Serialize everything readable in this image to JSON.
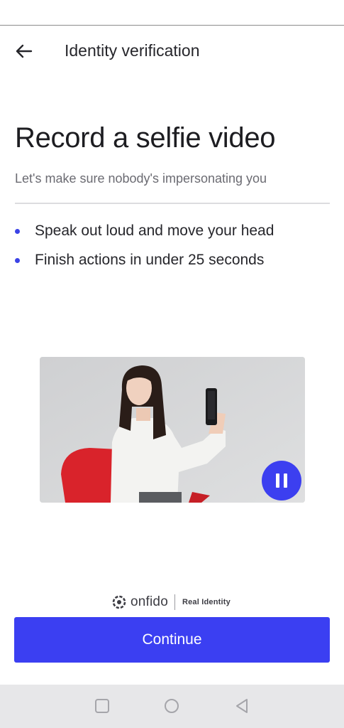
{
  "header": {
    "title": "Identity verification",
    "back_icon": "arrow-left-icon"
  },
  "main": {
    "heading": "Record a selfie video",
    "subtitle": "Let's make sure nobody's impersonating you",
    "bullets": [
      "Speak out loud and move your head",
      "Finish actions in under 25 seconds"
    ],
    "video": {
      "state": "playing",
      "control_icon": "pause-icon"
    }
  },
  "branding": {
    "logo_icon": "onfido-logo-icon",
    "name": "onfido",
    "tagline": "Real Identity"
  },
  "actions": {
    "continue_label": "Continue"
  },
  "system_nav": {
    "items": [
      "recent-apps-icon",
      "home-icon",
      "back-triangle-icon"
    ]
  },
  "colors": {
    "accent": "#3b3ff2",
    "bullet": "#3b43e6",
    "text": "#1d1d21",
    "muted": "#6b6b72"
  }
}
